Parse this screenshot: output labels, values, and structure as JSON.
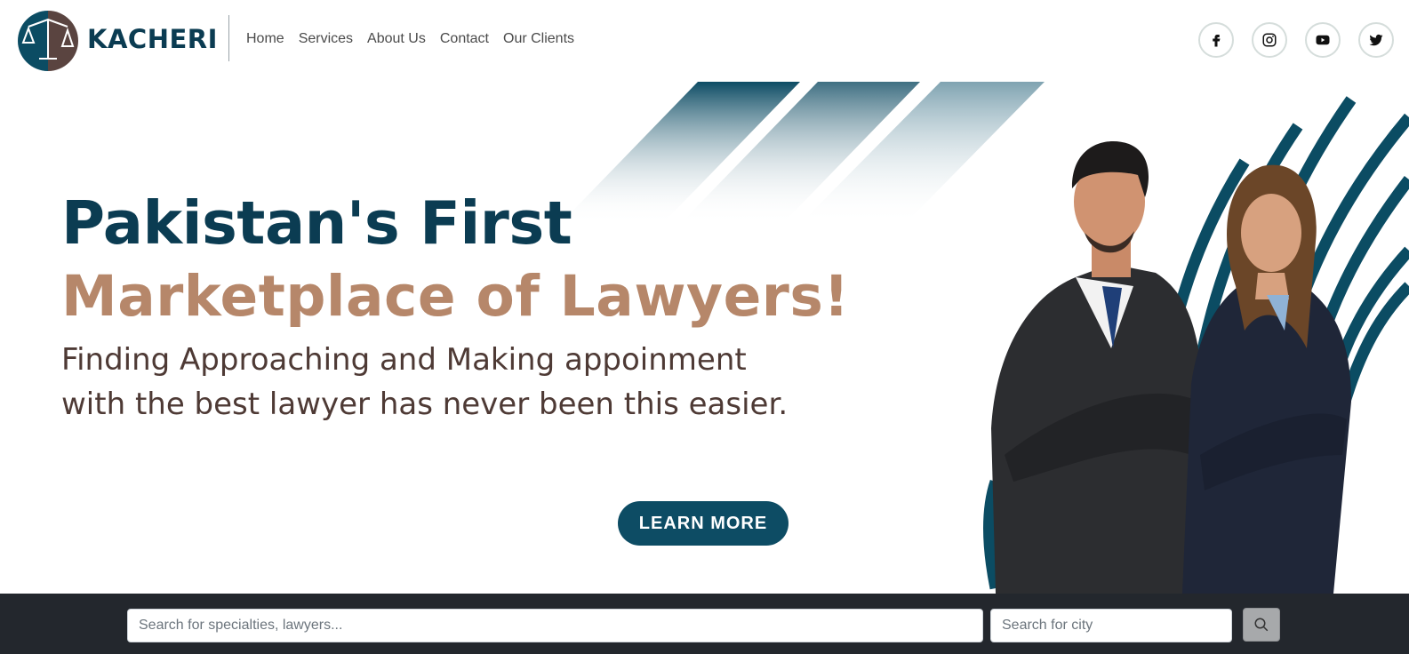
{
  "header": {
    "brand": "KACHERI",
    "nav": [
      {
        "label": "Home"
      },
      {
        "label": "Services"
      },
      {
        "label": "About Us"
      },
      {
        "label": "Contact"
      },
      {
        "label": "Our Clients"
      }
    ],
    "socials": [
      {
        "icon": "facebook-icon"
      },
      {
        "icon": "instagram-icon"
      },
      {
        "icon": "youtube-icon"
      },
      {
        "icon": "twitter-icon"
      }
    ]
  },
  "hero": {
    "headline_line1": "Pakistan's First",
    "headline_line2": "Marketplace of Lawyers!",
    "subline": "Finding Approaching and Making appoinment with the best lawyer has never been this easier.",
    "cta_label": "LEARN MORE"
  },
  "search": {
    "main_placeholder": "Search for specialties, lawyers...",
    "city_placeholder": "Search for city",
    "button_icon": "search-icon"
  },
  "colors": {
    "primary": "#0b3c52",
    "accent": "#b6876a",
    "text_dark": "#4e3a35",
    "searchbar_bg": "#23272d"
  }
}
